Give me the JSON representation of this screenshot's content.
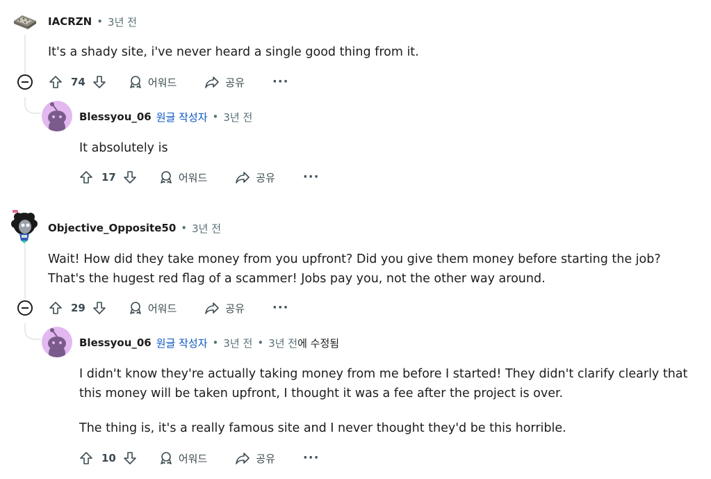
{
  "labels": {
    "award": "어워드",
    "share": "공유",
    "more": "···",
    "op_badge": "원글 작성자",
    "separator": "•"
  },
  "comments": [
    {
      "username": "IACRZN",
      "time": "3년 전",
      "body": [
        "It's a shady site, i've never heard a single good thing from it."
      ],
      "score": "74"
    },
    {
      "username": "Blessyou_06",
      "time": "3년 전",
      "body": [
        "It absolutely is"
      ],
      "score": "17"
    },
    {
      "username": "Objective_Opposite50",
      "time": "3년 전",
      "body": [
        "Wait! How did they take money from you upfront? Did you give them money before starting the job?",
        "That's the hugest red flag of a scammer! Jobs pay you, not the other way around."
      ],
      "score": "29"
    },
    {
      "username": "Blessyou_06",
      "time": "3년 전",
      "edited_time": "3년 전",
      "edited_suffix": "에 수정됨",
      "body": [
        "I didn't know they're actually taking money from me before I started! They didn't clarify clearly that",
        "this money will be taken upfront, I thought it was a fee after the project is over.",
        "The thing is, it's a really famous site and I never thought they'd be this horrible."
      ],
      "score": "10"
    }
  ]
}
